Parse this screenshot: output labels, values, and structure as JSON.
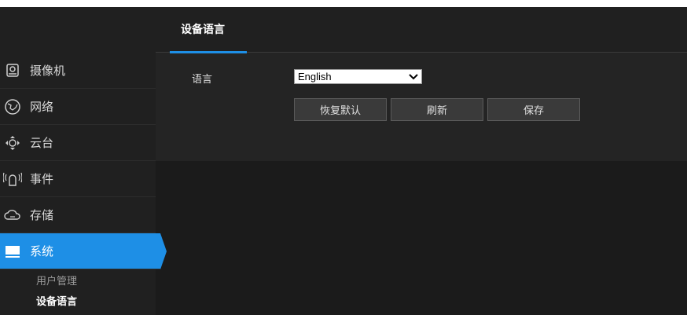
{
  "tab": {
    "label": "设备语言"
  },
  "sidebar": {
    "items": [
      {
        "label": "摄像机",
        "icon": "camera-icon"
      },
      {
        "label": "网络",
        "icon": "globe-icon"
      },
      {
        "label": "云台",
        "icon": "ptz-icon"
      },
      {
        "label": "事件",
        "icon": "alarm-icon"
      },
      {
        "label": "存储",
        "icon": "cloud-storage-icon"
      },
      {
        "label": "系统",
        "icon": "monitor-icon"
      }
    ],
    "sub_items": [
      {
        "label": "用户管理"
      },
      {
        "label": "设备语言"
      }
    ]
  },
  "form": {
    "language_label": "语言",
    "language_value": "English"
  },
  "buttons": {
    "restore": "恢复默认",
    "refresh": "刷新",
    "save": "保存"
  },
  "colors": {
    "accent": "#1e8fe6",
    "background": "#1b1b1b",
    "panel": "#242424"
  }
}
